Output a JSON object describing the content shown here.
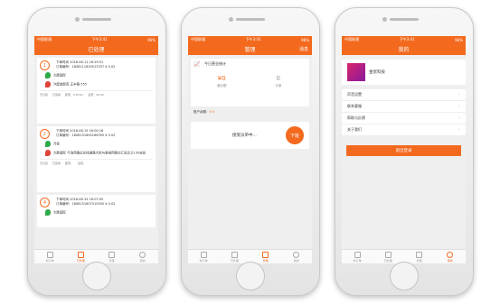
{
  "status": {
    "carrier": "中国联通",
    "time": "下午3:41",
    "battery": "96%"
  },
  "tabs": [
    "新订单",
    "已处理",
    "管理",
    "我的"
  ],
  "screen1": {
    "title": "已处理",
    "orders": [
      {
        "num": "1",
        "time": "下单时间 2018-08-11 16:29:51",
        "order_no": "订单编号：1808111829513337",
        "order_unit": "¥ 0.02",
        "from": "大胜国际",
        "to": "汽配装卸库 正丰路 555",
        "pay": "已付完",
        "status": "已完成",
        "distance": "距离：0.67km",
        "fee": "运费：¥0.02"
      },
      {
        "num": "2",
        "time": "下单时间 2018-08-15 16:00:18",
        "order_no": "订单编号：1808151600166395",
        "order_unit": "¥ 0.02",
        "from": "齐家",
        "to": "大胜国际 弓泡西路近光线道路大街与泰绰西路交汇处北之130米处",
        "pay": "已付完",
        "status": "已完成",
        "distance": "距离：",
        "fee": "运费："
      },
      {
        "num": "4",
        "time": "下单时间 2018-08-15 16:07:05",
        "order_no": "订单编号：1808151607010550",
        "order_unit": "¥ 0.02",
        "from": "大胜国际",
        "to": "",
        "pay": "",
        "status": "",
        "distance": "",
        "fee": ""
      }
    ]
  },
  "screen2": {
    "title": "管理",
    "right": "消息",
    "card_title": "今日营业统计",
    "stat1_value": "¥0",
    "stat1_label": "营业额",
    "stat2_value": "0",
    "stat2_label": "订单",
    "balance_label": "账户余额：",
    "balance_value": "¥ 0",
    "grab_text": "接受派单中...",
    "grab_button": "下班"
  },
  "screen3": {
    "title": "我的",
    "name": "金优科技",
    "menu": [
      "声音设置",
      "联系客服",
      "帮助与反馈",
      "关于我们"
    ],
    "logout": "退出登录"
  }
}
